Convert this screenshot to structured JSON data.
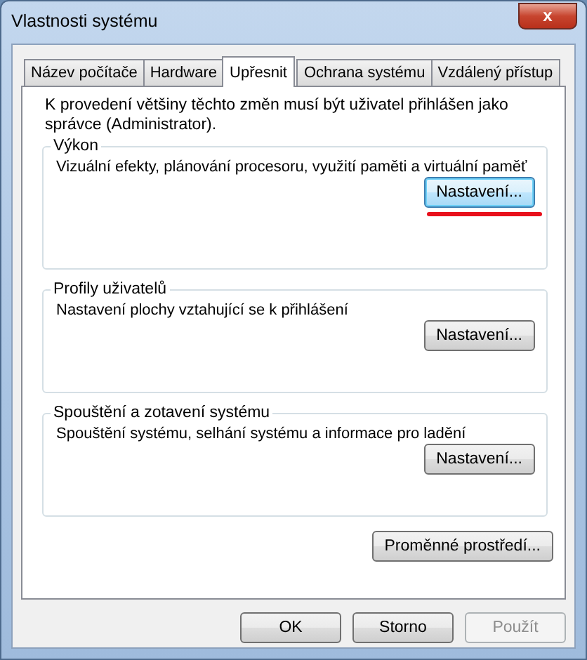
{
  "window": {
    "title": "Vlastnosti systému",
    "close_label": "x"
  },
  "tabs": [
    {
      "label": "Název počítače",
      "selected": false
    },
    {
      "label": "Hardware",
      "selected": false
    },
    {
      "label": "Upřesnit",
      "selected": true
    },
    {
      "label": "Ochrana systému",
      "selected": false
    },
    {
      "label": "Vzdálený přístup",
      "selected": false
    }
  ],
  "notice": "K provedení většiny těchto změn musí být uživatel přihlášen jako správce (Administrator).",
  "groups": [
    {
      "title": "Výkon",
      "description": "Vizuální efekty, plánování procesoru, využití paměti a virtuální paměť",
      "button": "Nastavení...",
      "focused": true,
      "underlined": true
    },
    {
      "title": "Profily uživatelů",
      "description": "Nastavení plochy vztahující se k přihlášení",
      "button": "Nastavení...",
      "focused": false,
      "underlined": false
    },
    {
      "title": "Spouštění a zotavení systému",
      "description": "Spouštění systému, selhání systému a informace pro ladění",
      "button": "Nastavení...",
      "focused": false,
      "underlined": false
    }
  ],
  "environment_button": "Proměnné prostředí...",
  "buttons": [
    {
      "label": "OK",
      "disabled": false
    },
    {
      "label": "Storno",
      "disabled": false
    },
    {
      "label": "Použít",
      "disabled": true
    }
  ]
}
